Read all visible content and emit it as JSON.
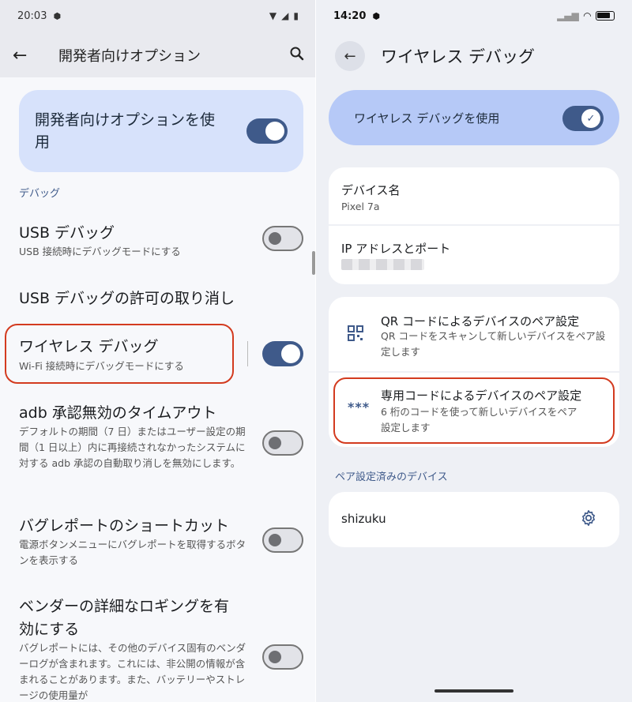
{
  "left": {
    "status": {
      "time": "20:03"
    },
    "topbar": {
      "title": "開発者向けオプション"
    },
    "master": {
      "label": "開発者向けオプションを使用",
      "on": true
    },
    "section": "デバッグ",
    "items": [
      {
        "title": "USB デバッグ",
        "subtitle": "USB 接続時にデバッグモードにする",
        "toggle": "off"
      },
      {
        "title": "USB デバッグの許可の取り消し",
        "subtitle": ""
      },
      {
        "title": "ワイヤレス デバッグ",
        "subtitle": "Wi-Fi 接続時にデバッグモードにする",
        "toggle": "on"
      },
      {
        "title": "adb 承認無効のタイムアウト",
        "subtitle": "デフォルトの期間（7 日）またはユーザー設定の期間（1 日以上）内に再接続されなかったシステムに対する adb 承認の自動取り消しを無効にします。",
        "toggle": "off"
      },
      {
        "title": "バグレポートのショートカット",
        "subtitle": "電源ボタンメニューにバグレポートを取得するボタンを表示する",
        "toggle": "off"
      },
      {
        "title": "ベンダーの詳細なロギングを有効にする",
        "subtitle": "バグレポートには、その他のデバイス固有のベンダーログが含まれます。これには、非公開の情報が含まれることがあります。また、バッテリーやストレージの使用量が",
        "toggle": "off"
      }
    ]
  },
  "right": {
    "status": {
      "time": "14:20"
    },
    "title": "ワイヤレス デバッグ",
    "master": {
      "label": "ワイヤレス デバッグを使用",
      "on": true
    },
    "device": {
      "name_label": "デバイス名",
      "name_value": "Pixel 7a",
      "ip_label": "IP アドレスとポート"
    },
    "pairing": [
      {
        "title": "QR コードによるデバイスのペア設定",
        "subtitle": "QR コードをスキャンして新しいデバイスをペア設定します",
        "icon": "qr-icon"
      },
      {
        "title": "専用コードによるデバイスのペア設定",
        "subtitle": "6 桁のコードを使って新しいデバイスをペア設定します",
        "icon": "password-dots-icon"
      }
    ],
    "paired_section": "ペア設定済みのデバイス",
    "paired_devices": [
      {
        "name": "shizuku"
      }
    ]
  }
}
